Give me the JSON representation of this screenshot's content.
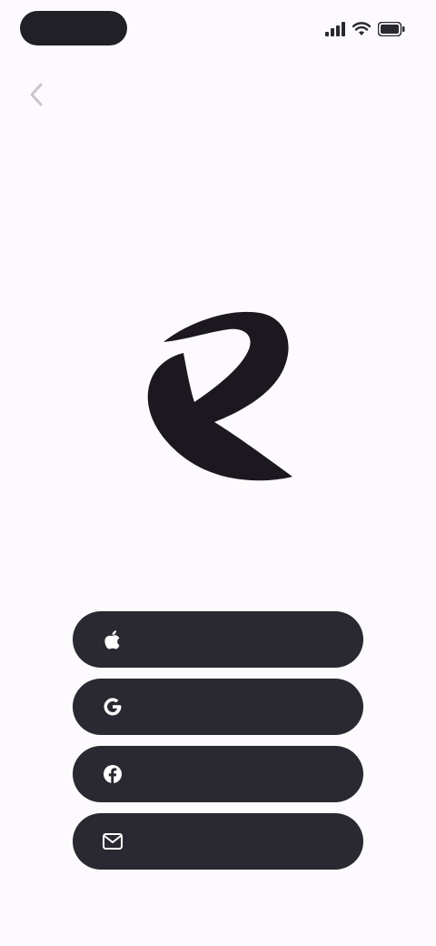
{
  "status_bar": {
    "time": "",
    "icons": [
      "signal-icon",
      "wifi-icon",
      "battery-icon"
    ]
  },
  "nav": {
    "back_icon": "chevron-left-icon"
  },
  "brand": {
    "logo": "brand-logo",
    "tagline": ""
  },
  "login_options": [
    {
      "icon": "apple-icon",
      "label": ""
    },
    {
      "icon": "google-icon",
      "label": ""
    },
    {
      "icon": "facebook-icon",
      "label": ""
    },
    {
      "icon": "email-icon",
      "label": ""
    }
  ],
  "colors": {
    "background": "#fdfafd",
    "button": "#2a2830",
    "button_text": "#ffffff",
    "tagline": "#6f6b72"
  }
}
